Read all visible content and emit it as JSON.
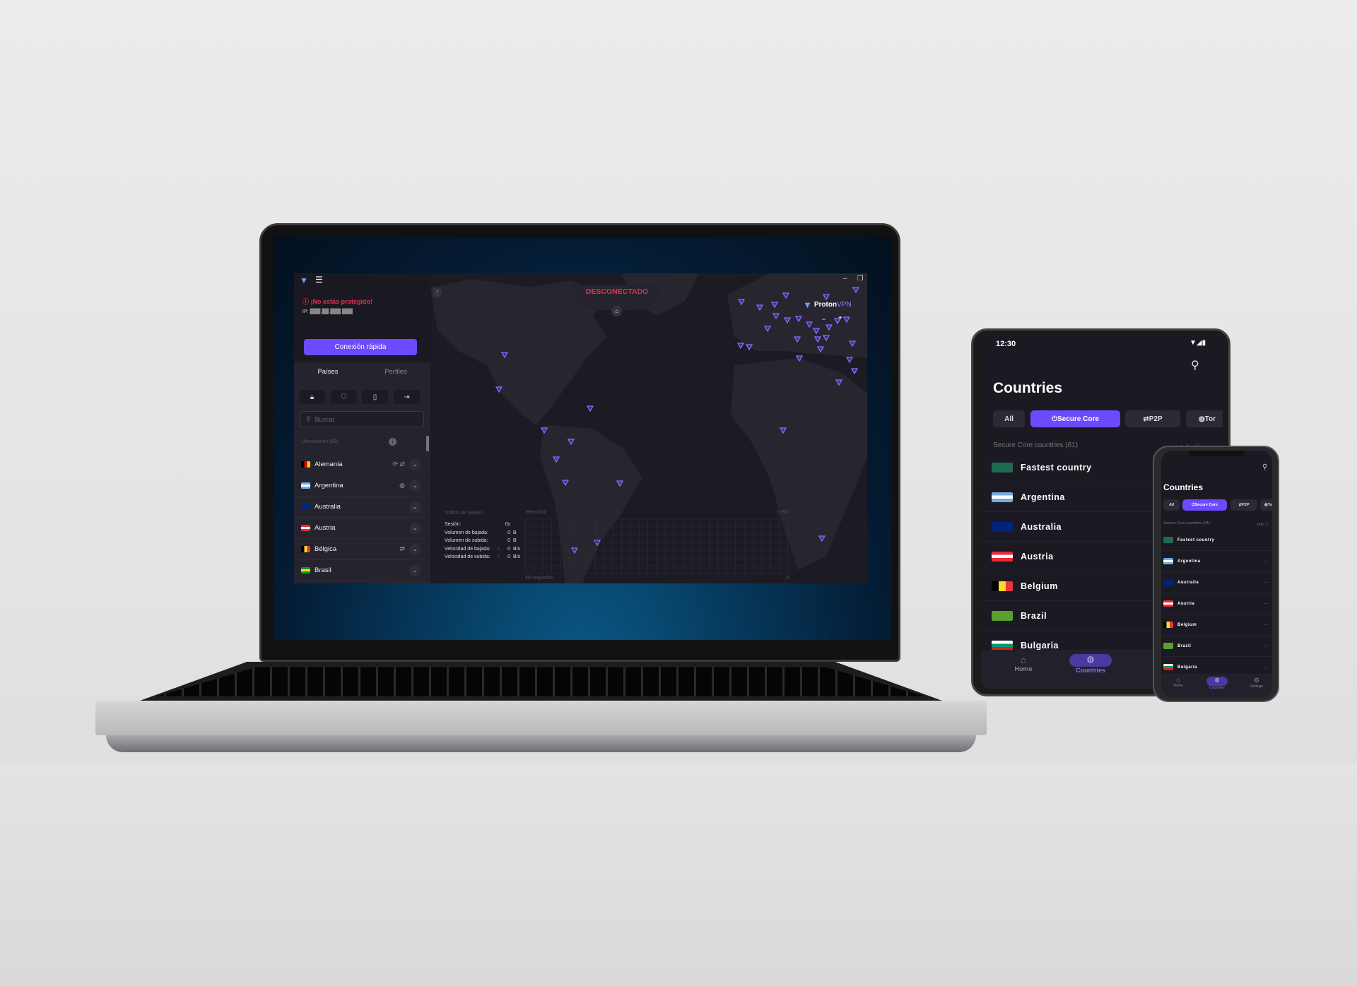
{
  "colors": {
    "accent": "#6d4aff",
    "danger": "#e0324b",
    "background": "#1c1b24"
  },
  "desktop": {
    "titlebar": {
      "logo_icon": "protonvpn-logo-icon",
      "menu_icon": "hamburger-menu-icon",
      "minimize": "–",
      "restore": "❐",
      "close": "✕"
    },
    "status": {
      "warning": "¡No estás protegido!",
      "ip_label": "IP:",
      "ip_value": "███.██.███.███"
    },
    "quick_connect": "Conexión rápida",
    "tabs": [
      "Países",
      "Perfiles"
    ],
    "filter_icons": [
      "lock-icon",
      "shield-icon",
      "tor-icon",
      "split-icon"
    ],
    "search_placeholder": "Buscar",
    "locations_label": "Ubicaciones (69)",
    "countries": [
      {
        "name": "Alemania",
        "features": "⟳ ⇄",
        "flag": [
          "#000",
          "#d00",
          "#fc0"
        ]
      },
      {
        "name": "Argentina",
        "features": "◍",
        "flag": [
          "#74acdf",
          "#fff",
          "#74acdf"
        ]
      },
      {
        "name": "Australia",
        "features": "",
        "flag": [
          "#00247d",
          "#00247d",
          "#00247d"
        ]
      },
      {
        "name": "Austria",
        "features": "",
        "flag": [
          "#ed2939",
          "#fff",
          "#ed2939"
        ]
      },
      {
        "name": "Bélgica",
        "features": "⇄",
        "flag": [
          "#000",
          "#fdda24",
          "#ef3340"
        ]
      },
      {
        "name": "Brasil",
        "features": "",
        "flag": [
          "#009c3b",
          "#ffdf00",
          "#009c3b"
        ]
      }
    ],
    "map": {
      "status": "DESCONECTADO",
      "brand_a": "Proton",
      "brand_b": "VPN",
      "zoom_out": "−",
      "zoom_in": "+",
      "collapse": "‹"
    },
    "traffic": {
      "title": "Tráfico de Sesión",
      "rows": [
        {
          "label": "Sesión:",
          "value": "0s",
          "unit": ""
        },
        {
          "label": "Volumen de bajada:",
          "value": "0",
          "unit": "B"
        },
        {
          "label": "Volumen de subida:",
          "value": "0",
          "unit": "B"
        },
        {
          "label": "Velocidad de bajada:",
          "value": "0",
          "unit": "B/s",
          "arrow": "↓"
        },
        {
          "label": "Velocidad de subida:",
          "value": "0",
          "unit": "B/s",
          "arrow": "↑"
        }
      ],
      "graph_title": "Velocidad",
      "graph_max": "0 B/s",
      "graph_span": "60 segundos",
      "graph_zero": "0"
    }
  },
  "mobile": {
    "time": "12:30",
    "title": "Countries",
    "chips": [
      "All",
      "Secure Core",
      "P2P",
      "Tor"
    ],
    "section": "Secure Core countries (61)",
    "info": "Info ⓘ",
    "rows": [
      {
        "name": "Fastest country",
        "flag": [
          "#1f6b52",
          "#1f6b52",
          "#1f6b52"
        ]
      },
      {
        "name": "Argentina",
        "flag": [
          "#74acdf",
          "#fff",
          "#74acdf"
        ]
      },
      {
        "name": "Australia",
        "flag": [
          "#00247d",
          "#00247d",
          "#00247d"
        ]
      },
      {
        "name": "Austria",
        "flag": [
          "#ed2939",
          "#fff",
          "#ed2939"
        ]
      },
      {
        "name": "Belgium",
        "flag": [
          "#000",
          "#fdda24",
          "#ef3340"
        ]
      },
      {
        "name": "Brazil",
        "flag": [
          "#5aa02c",
          "#5aa02c",
          "#5aa02c"
        ]
      },
      {
        "name": "Bulgaria",
        "flag": [
          "#fff",
          "#00966e",
          "#d62612"
        ]
      }
    ],
    "nav": [
      "Home",
      "Countries",
      "Settings"
    ],
    "more": "···"
  }
}
